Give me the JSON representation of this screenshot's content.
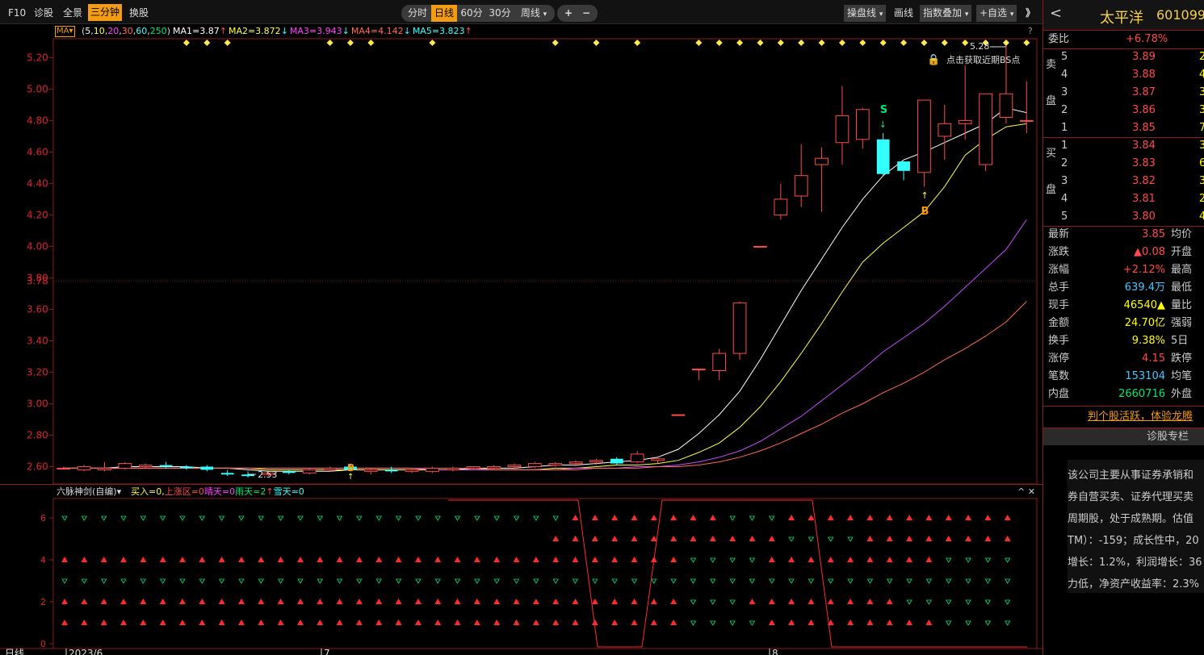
{
  "toolbar": {
    "left_tabs": [
      "F10",
      "诊股",
      "全景",
      "三分钟",
      "换股"
    ],
    "active_left": "三分钟",
    "period_tabs": [
      "分时",
      "日线",
      "60分",
      "30分",
      "周线"
    ],
    "period_active": "日线",
    "zoom_in": "+",
    "zoom_out": "−",
    "right_buttons": [
      "操盘线",
      "画线",
      "指数叠加",
      "+自选"
    ],
    "expand": "》"
  },
  "ma_legend": {
    "label": "MA",
    "params": "(5,10,20,30,60,250)",
    "params_parts": [
      "5",
      "10",
      "20",
      "30",
      "60",
      "250"
    ],
    "items": [
      {
        "text": "MA1=3.87",
        "arrow": "↑",
        "color": "#ffffff"
      },
      {
        "text": "MA2=3.872",
        "arrow": "↓",
        "color": "#ffff40"
      },
      {
        "text": "MA3=3.943",
        "arrow": "↓",
        "color": "#ff40ff"
      },
      {
        "text": "MA4=4.142",
        "arrow": "↓",
        "color": "#ff6a4d"
      },
      {
        "text": "MA5=3.823",
        "arrow": "↑",
        "color": "#33ffff"
      }
    ],
    "help": "?"
  },
  "colors": {
    "up": "#ff4a4a",
    "down": "#33ffff",
    "ma1": "#ffffff",
    "ma2": "#ffff40",
    "ma3": "#c44bff",
    "ma4": "#ff6a4d",
    "accent": "#f39c12",
    "grid_border": "#8b1a1a"
  },
  "bs_panel": {
    "lock_text": "点击获取近期BS点",
    "high_label": "5.28",
    "low_label": "2.53",
    "s_label": "S",
    "b_label": "B",
    "b_low_label": "B"
  },
  "x_labels": [
    "2023/6",
    "7",
    "8"
  ],
  "period_label": "日线",
  "indicator": {
    "name": "六脉神剑(自编)",
    "items": [
      {
        "text": "买入=0,",
        "color": "#ffff40"
      },
      {
        "text": "上涨区=0",
        "color": "#ff4a4a"
      },
      {
        "text": "晴天=0",
        "color": "#ff40ff"
      },
      {
        "text": "雨天=2",
        "color": "#00e676"
      },
      {
        "text": "↑",
        "color": "#ff4a4a"
      },
      {
        "text": "雪天=0",
        "color": "#33ffff"
      }
    ],
    "controls": "^ ✕",
    "y_ticks": [
      "6",
      "4",
      "2",
      "0"
    ],
    "rows": [
      {
        "level": 6,
        "marks": "dddddddddddddddddddddddddduuuuuuuuddduuuuuuuuuuuuuuu"
      },
      {
        "level": 5,
        "marks": "-------------------------uuuuuuuuuuuudddduuuuuuuuudduuuuu"
      },
      {
        "level": 4,
        "marks": "uuuuuuuuuuuuuuuuuuuuuuuuuuuuuuuudddduuuuuuuuudddddddd"
      },
      {
        "level": 3,
        "marks": "dddddddddddddddddddddddddddddddddddddddddddddddddd"
      },
      {
        "level": 2,
        "marks": "uuuuuuuuuuuuuuuuuuuuuuuuuuuuuuuuddduuuuuuuuddddddddd"
      },
      {
        "level": 1,
        "marks": "uuuuuuuuuuuuuuuuuuuuuuuuuuuuuuuudddduuuuuuuuudddddddd"
      }
    ]
  },
  "chart_data": {
    "type": "candlestick",
    "title": "太平洋 601099 日线",
    "ylim": [
      2.5,
      5.32
    ],
    "y_ticks": [
      "5.20",
      "5.00",
      "4.80",
      "4.60",
      "4.40",
      "4.20",
      "4.00",
      "3.80",
      "3.60",
      "3.40",
      "3.20",
      "3.00",
      "2.80",
      "2.60"
    ],
    "current_price": 3.78,
    "x_labels": [
      "2023/6",
      "7",
      "8"
    ],
    "candles": [
      {
        "o": 2.59,
        "h": 2.6,
        "l": 2.58,
        "c": 2.59
      },
      {
        "o": 2.58,
        "h": 2.61,
        "l": 2.57,
        "c": 2.6
      },
      {
        "o": 2.58,
        "h": 2.63,
        "l": 2.57,
        "c": 2.59
      },
      {
        "o": 2.59,
        "h": 2.63,
        "l": 2.58,
        "c": 2.62
      },
      {
        "o": 2.6,
        "h": 2.62,
        "l": 2.59,
        "c": 2.61
      },
      {
        "o": 2.61,
        "h": 2.63,
        "l": 2.59,
        "c": 2.6
      },
      {
        "o": 2.6,
        "h": 2.61,
        "l": 2.58,
        "c": 2.59
      },
      {
        "o": 2.6,
        "h": 2.61,
        "l": 2.57,
        "c": 2.58
      },
      {
        "o": 2.56,
        "h": 2.58,
        "l": 2.54,
        "c": 2.55
      },
      {
        "o": 2.55,
        "h": 2.57,
        "l": 2.53,
        "c": 2.54
      },
      {
        "o": 2.55,
        "h": 2.57,
        "l": 2.54,
        "c": 2.56
      },
      {
        "o": 2.57,
        "h": 2.58,
        "l": 2.55,
        "c": 2.56
      },
      {
        "o": 2.56,
        "h": 2.59,
        "l": 2.55,
        "c": 2.58
      },
      {
        "o": 2.58,
        "h": 2.6,
        "l": 2.57,
        "c": 2.59
      },
      {
        "o": 2.6,
        "h": 2.61,
        "l": 2.57,
        "c": 2.58
      },
      {
        "o": 2.57,
        "h": 2.59,
        "l": 2.55,
        "c": 2.58
      },
      {
        "o": 2.58,
        "h": 2.6,
        "l": 2.56,
        "c": 2.57
      },
      {
        "o": 2.57,
        "h": 2.59,
        "l": 2.56,
        "c": 2.58
      },
      {
        "o": 2.57,
        "h": 2.6,
        "l": 2.56,
        "c": 2.59
      },
      {
        "o": 2.58,
        "h": 2.6,
        "l": 2.57,
        "c": 2.59
      },
      {
        "o": 2.59,
        "h": 2.6,
        "l": 2.58,
        "c": 2.6
      },
      {
        "o": 2.59,
        "h": 2.61,
        "l": 2.58,
        "c": 2.6
      },
      {
        "o": 2.6,
        "h": 2.62,
        "l": 2.58,
        "c": 2.61
      },
      {
        "o": 2.6,
        "h": 2.63,
        "l": 2.59,
        "c": 2.62
      },
      {
        "o": 2.61,
        "h": 2.63,
        "l": 2.6,
        "c": 2.62
      },
      {
        "o": 2.62,
        "h": 2.64,
        "l": 2.6,
        "c": 2.63
      },
      {
        "o": 2.63,
        "h": 2.65,
        "l": 2.61,
        "c": 2.64
      },
      {
        "o": 2.65,
        "h": 2.66,
        "l": 2.61,
        "c": 2.62
      },
      {
        "o": 2.63,
        "h": 2.7,
        "l": 2.62,
        "c": 2.68
      },
      {
        "o": 2.64,
        "h": 2.66,
        "l": 2.62,
        "c": 2.65
      },
      {
        "o": 2.93,
        "h": 2.93,
        "l": 2.93,
        "c": 2.93
      },
      {
        "o": 3.22,
        "h": 3.22,
        "l": 3.15,
        "c": 3.22
      },
      {
        "o": 3.21,
        "h": 3.35,
        "l": 3.15,
        "c": 3.32
      },
      {
        "o": 3.32,
        "h": 3.65,
        "l": 3.28,
        "c": 3.64
      },
      {
        "o": 4.0,
        "h": 4.0,
        "l": 4.0,
        "c": 4.0
      },
      {
        "o": 4.2,
        "h": 4.4,
        "l": 4.17,
        "c": 4.3
      },
      {
        "o": 4.32,
        "h": 4.65,
        "l": 4.25,
        "c": 4.45
      },
      {
        "o": 4.52,
        "h": 4.63,
        "l": 4.22,
        "c": 4.56
      },
      {
        "o": 4.66,
        "h": 5.02,
        "l": 4.52,
        "c": 4.83
      },
      {
        "o": 4.68,
        "h": 4.88,
        "l": 4.62,
        "c": 4.87
      },
      {
        "o": 4.68,
        "h": 4.72,
        "l": 4.45,
        "c": 4.46
      },
      {
        "o": 4.54,
        "h": 4.54,
        "l": 4.42,
        "c": 4.48
      },
      {
        "o": 4.47,
        "h": 4.93,
        "l": 4.38,
        "c": 4.93
      },
      {
        "o": 4.7,
        "h": 4.9,
        "l": 4.55,
        "c": 4.78
      },
      {
        "o": 4.78,
        "h": 5.15,
        "l": 4.68,
        "c": 4.8
      },
      {
        "o": 4.52,
        "h": 4.97,
        "l": 4.48,
        "c": 4.97
      },
      {
        "o": 4.82,
        "h": 5.28,
        "l": 4.78,
        "c": 4.97
      },
      {
        "o": 4.8,
        "h": 5.05,
        "l": 4.72,
        "c": 4.8
      }
    ],
    "series": [
      {
        "name": "MA1",
        "values": [
          2.59,
          2.59,
          2.59,
          2.6,
          2.6,
          2.6,
          2.6,
          2.59,
          2.59,
          2.58,
          2.57,
          2.57,
          2.57,
          2.57,
          2.58,
          2.58,
          2.58,
          2.58,
          2.58,
          2.58,
          2.59,
          2.59,
          2.59,
          2.6,
          2.61,
          2.61,
          2.62,
          2.63,
          2.64,
          2.66,
          2.71,
          2.81,
          2.93,
          3.08,
          3.28,
          3.5,
          3.72,
          3.92,
          4.12,
          4.3,
          4.45,
          4.55,
          4.6,
          4.66,
          4.72,
          4.78,
          4.88,
          4.85
        ]
      },
      {
        "name": "MA2",
        "values": [
          2.59,
          2.59,
          2.59,
          2.59,
          2.59,
          2.59,
          2.59,
          2.59,
          2.59,
          2.59,
          2.58,
          2.58,
          2.58,
          2.58,
          2.58,
          2.58,
          2.58,
          2.58,
          2.58,
          2.58,
          2.58,
          2.58,
          2.58,
          2.58,
          2.59,
          2.59,
          2.6,
          2.61,
          2.61,
          2.62,
          2.64,
          2.69,
          2.75,
          2.85,
          2.98,
          3.14,
          3.32,
          3.51,
          3.71,
          3.9,
          4.02,
          4.12,
          4.22,
          4.38,
          4.58,
          4.68,
          4.76,
          4.78
        ]
      },
      {
        "name": "MA3",
        "values": [
          2.59,
          2.59,
          2.59,
          2.59,
          2.59,
          2.59,
          2.59,
          2.59,
          2.59,
          2.59,
          2.59,
          2.59,
          2.59,
          2.59,
          2.59,
          2.59,
          2.59,
          2.59,
          2.58,
          2.58,
          2.58,
          2.58,
          2.58,
          2.58,
          2.58,
          2.59,
          2.59,
          2.59,
          2.6,
          2.6,
          2.61,
          2.63,
          2.66,
          2.7,
          2.76,
          2.84,
          2.92,
          3.02,
          3.12,
          3.22,
          3.33,
          3.42,
          3.51,
          3.62,
          3.74,
          3.86,
          3.98,
          4.17
        ]
      },
      {
        "name": "MA4",
        "values": [
          2.59,
          2.59,
          2.59,
          2.59,
          2.59,
          2.59,
          2.59,
          2.59,
          2.59,
          2.59,
          2.59,
          2.59,
          2.59,
          2.59,
          2.59,
          2.59,
          2.59,
          2.59,
          2.59,
          2.59,
          2.59,
          2.58,
          2.58,
          2.58,
          2.58,
          2.58,
          2.59,
          2.59,
          2.59,
          2.6,
          2.6,
          2.61,
          2.63,
          2.66,
          2.7,
          2.75,
          2.81,
          2.87,
          2.94,
          3.0,
          3.07,
          3.13,
          3.2,
          3.28,
          3.35,
          3.43,
          3.52,
          3.65
        ]
      }
    ],
    "bs_diamonds_x": [
      6,
      7,
      8,
      13,
      14,
      15,
      18,
      24,
      26,
      28,
      31,
      32,
      33,
      34,
      35,
      36,
      37,
      38,
      39,
      40,
      41,
      42,
      43,
      44,
      45,
      46,
      47,
      48
    ]
  },
  "sidebar": {
    "name": "太平洋",
    "code": "601099",
    "back": "<",
    "wtb_label": "委比",
    "wtb_value": "+6.78%",
    "sell_side": "卖盘",
    "buy_side": "买盘",
    "sell": [
      {
        "lvl": "5",
        "price": "3.89",
        "vol": "2"
      },
      {
        "lvl": "4",
        "price": "3.88",
        "vol": "4"
      },
      {
        "lvl": "3",
        "price": "3.87",
        "vol": "3"
      },
      {
        "lvl": "2",
        "price": "3.86",
        "vol": "3"
      },
      {
        "lvl": "1",
        "price": "3.85",
        "vol": "7"
      }
    ],
    "buy": [
      {
        "lvl": "1",
        "price": "3.84",
        "vol": "3"
      },
      {
        "lvl": "2",
        "price": "3.83",
        "vol": "6"
      },
      {
        "lvl": "3",
        "price": "3.82",
        "vol": "3"
      },
      {
        "lvl": "4",
        "price": "3.81",
        "vol": "2"
      },
      {
        "lvl": "5",
        "price": "3.80",
        "vol": "4"
      }
    ],
    "stats": [
      {
        "label": "最新",
        "value": "3.85",
        "cls": "up",
        "right": "均价"
      },
      {
        "label": "涨跌",
        "value": "▲0.08",
        "cls": "up",
        "right": "开盘"
      },
      {
        "label": "涨幅",
        "value": "+2.12%",
        "cls": "up",
        "right": "最高"
      },
      {
        "label": "总手",
        "value": "639.4万",
        "cls": "cy",
        "right": "最低"
      },
      {
        "label": "现手",
        "value": "46540▲",
        "cls": "yel",
        "right": "量比"
      },
      {
        "label": "金额",
        "value": "24.70亿",
        "cls": "yel",
        "right": "强弱"
      },
      {
        "label": "换手",
        "value": "9.38%",
        "cls": "yel",
        "right": "5日"
      },
      {
        "label": "涨停",
        "value": "4.15",
        "cls": "up",
        "right": "跌停"
      },
      {
        "label": "笔数",
        "value": "153104",
        "cls": "cy",
        "right": "均笔"
      },
      {
        "label": "内盘",
        "value": "2660716",
        "cls": "gr",
        "right": "外盘"
      }
    ],
    "promo": "判个股活跃，体验龙腾",
    "section_title": "诊股专栏",
    "analysis": [
      "该公司主要从事证券承销和",
      "券自营买卖、证券代理买卖",
      "周期股，处于成熟期。估值",
      "TM）：-159；成长性中，20",
      "增长：1.2%，利润增长：36",
      "力低，净资产收益率：2.3%"
    ]
  }
}
